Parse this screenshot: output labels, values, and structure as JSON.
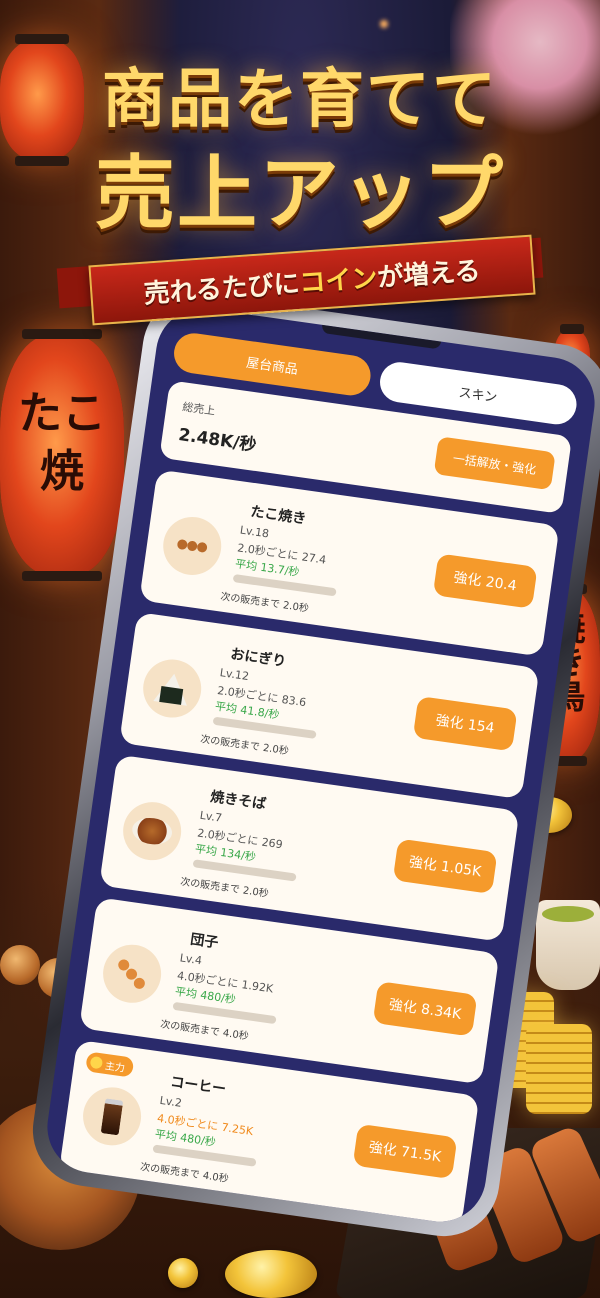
{
  "headline": {
    "line1": "商品を育てて",
    "line2": "売上アップ",
    "banner_pre": "売れるたびに",
    "banner_highlight": "コイン",
    "banner_post": "が増える"
  },
  "lanterns": {
    "left": "たこ焼",
    "right": "焼き鳥"
  },
  "app": {
    "tabs": [
      {
        "label": "屋台商品",
        "active": true
      },
      {
        "label": "スキン",
        "active": false
      }
    ],
    "summary": {
      "label": "総売上",
      "value": "2.48K/秒",
      "bulk_button": "一括解放・強化"
    },
    "items": [
      {
        "name": "たこ焼き",
        "level": "Lv.18",
        "rate": "2.0秒ごとに 27.4",
        "avg": "平均 13.7/秒",
        "progress": 0.0,
        "next": "次の販売まで 2.0秒",
        "button": "強化 20.4",
        "icon": "takoyaki-icon",
        "main": false
      },
      {
        "name": "おにぎり",
        "level": "Lv.12",
        "rate": "2.0秒ごとに 83.6",
        "avg": "平均 41.8/秒",
        "progress": 0.0,
        "next": "次の販売まで 2.0秒",
        "button": "強化 154",
        "icon": "onigiri-icon",
        "main": false
      },
      {
        "name": "焼きそば",
        "level": "Lv.7",
        "rate": "2.0秒ごとに 269",
        "avg": "平均 134/秒",
        "progress": 0.0,
        "next": "次の販売まで 2.0秒",
        "button": "強化 1.05K",
        "icon": "yakisoba-icon",
        "main": false
      },
      {
        "name": "団子",
        "level": "Lv.4",
        "rate": "4.0秒ごとに 1.92K",
        "avg": "平均 480/秒",
        "progress": 0.0,
        "next": "次の販売まで 4.0秒",
        "button": "強化 8.34K",
        "icon": "dango-icon",
        "main": false
      },
      {
        "name": "コーヒー",
        "level": "Lv.2",
        "rate": "4.0秒ごとに 7.25K",
        "avg": "平均 480/秒",
        "progress": 0.0,
        "next": "次の販売まで 4.0秒",
        "button": "強化 71.5K",
        "icon": "coffee-icon",
        "main": true,
        "badge": "主力"
      }
    ]
  },
  "colors": {
    "accent": "#f59a2b",
    "card": "#fffaf2",
    "screen": "#2a2a6b",
    "positive": "#3aa84a"
  }
}
